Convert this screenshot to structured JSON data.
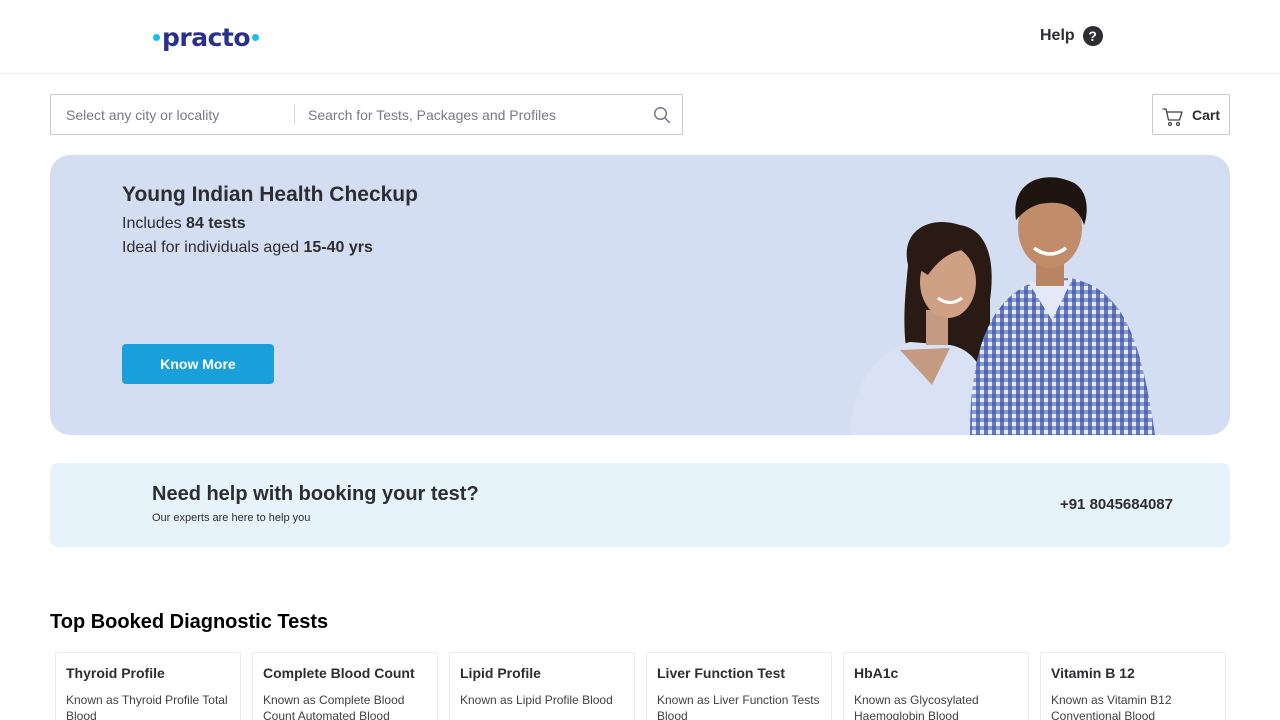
{
  "header": {
    "logo_text": "practo",
    "help_label": "Help",
    "help_icon": "?"
  },
  "search": {
    "city_placeholder": "Select any city or locality",
    "test_placeholder": "Search for Tests, Packages and Profiles"
  },
  "cart": {
    "label": "Cart"
  },
  "banner": {
    "title": "Young Indian Health Checkup",
    "line1_prefix": "Includes ",
    "line1_bold": "84 tests",
    "line2_prefix": "Ideal for individuals aged ",
    "line2_bold": "15-40 yrs",
    "button_label": "Know More"
  },
  "help_strip": {
    "title": "Need help with booking your test?",
    "subtitle": "Our experts are here to help you",
    "phone": "+91 8045684087"
  },
  "top_booked": {
    "title": "Top Booked Diagnostic Tests",
    "cards": [
      {
        "title": "Thyroid Profile",
        "desc": "Known as Thyroid Profile Total Blood"
      },
      {
        "title": "Complete Blood Count",
        "desc": "Known as Complete Blood Count Automated Blood"
      },
      {
        "title": "Lipid Profile",
        "desc": "Known as Lipid Profile Blood"
      },
      {
        "title": "Liver Function Test",
        "desc": "Known as Liver Function Tests Blood"
      },
      {
        "title": "HbA1c",
        "desc": "Known as Glycosylated Haemoglobin Blood"
      },
      {
        "title": "Vitamin B 12",
        "desc": "Known as Vitamin B12 Conventional Blood"
      }
    ]
  },
  "colors": {
    "brand": "#28328c",
    "accent": "#14bef0",
    "button": "#199fd9",
    "banner_bg": "#d4def3",
    "help_bg": "#e6f3fb"
  }
}
